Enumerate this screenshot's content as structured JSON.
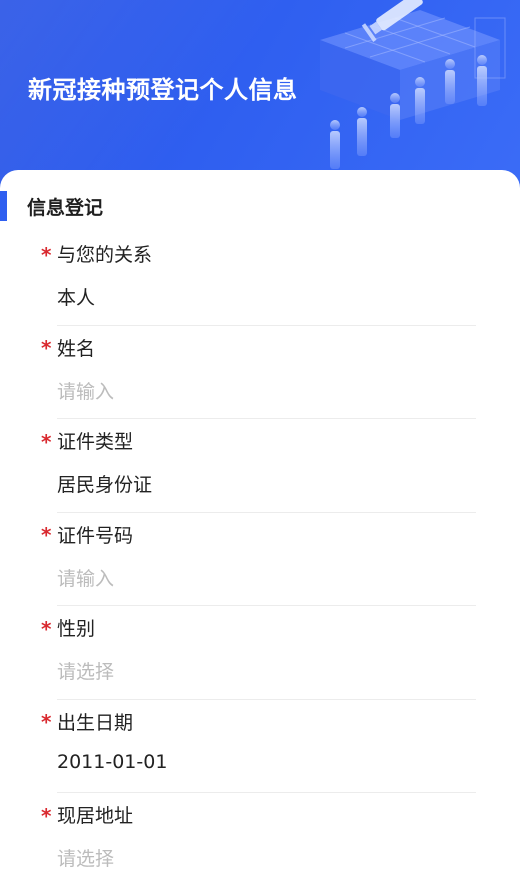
{
  "header": {
    "title": "新冠接种预登记个人信息"
  },
  "section": {
    "title": "信息登记"
  },
  "form": {
    "fields": [
      {
        "label": "与您的关系",
        "value": "本人",
        "is_placeholder": false,
        "required": true
      },
      {
        "label": "姓名",
        "value": "请输入",
        "is_placeholder": true,
        "required": true
      },
      {
        "label": "证件类型",
        "value": "居民身份证",
        "is_placeholder": false,
        "required": true
      },
      {
        "label": "证件号码",
        "value": "请输入",
        "is_placeholder": true,
        "required": true
      },
      {
        "label": "性别",
        "value": "请选择",
        "is_placeholder": true,
        "required": true
      },
      {
        "label": "出生日期",
        "value": "2011-01-01",
        "is_placeholder": false,
        "required": true
      },
      {
        "label": "现居地址",
        "value": "请选择",
        "is_placeholder": true,
        "required": true
      }
    ],
    "required_mark": "*"
  },
  "colors": {
    "brand_blue": "#2f5ff0",
    "required_red": "#d9292f",
    "placeholder_gray": "#bcbcbc"
  }
}
